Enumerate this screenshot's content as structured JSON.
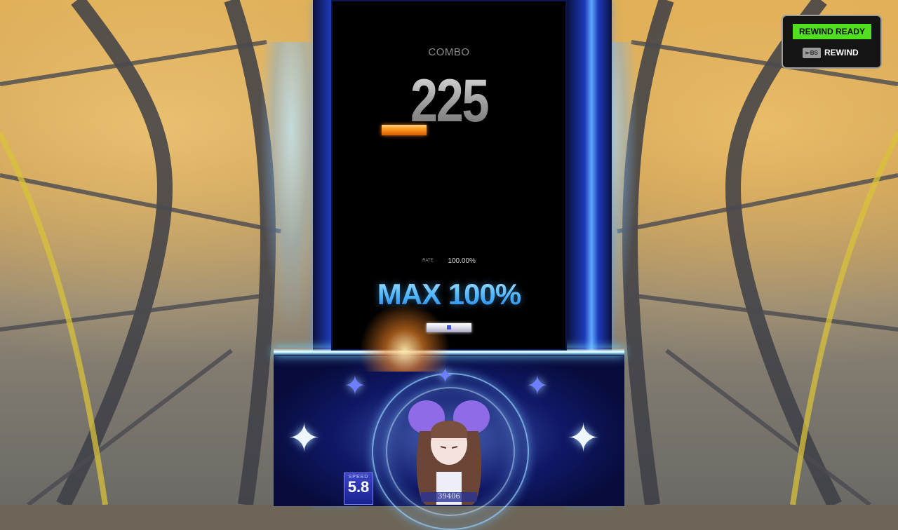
{
  "hud": {
    "combo_label": "COMBO",
    "combo_value": "225",
    "rate_label": "RATE",
    "rate_value": "100.00%",
    "judgement": "MAX 100%",
    "speed_label": "SPEED",
    "speed_value": "5.8",
    "score_value": "39406"
  },
  "rewind_panel": {
    "status": "REWIND READY",
    "key_label": "⇤BS",
    "action_label": "REWIND"
  },
  "colors": {
    "rewind_ready_bg": "#4fe01f",
    "judgement_blue": "#4fb6ff",
    "note_orange": "#ff9a22",
    "frame_blue": "#1d3ab8"
  }
}
